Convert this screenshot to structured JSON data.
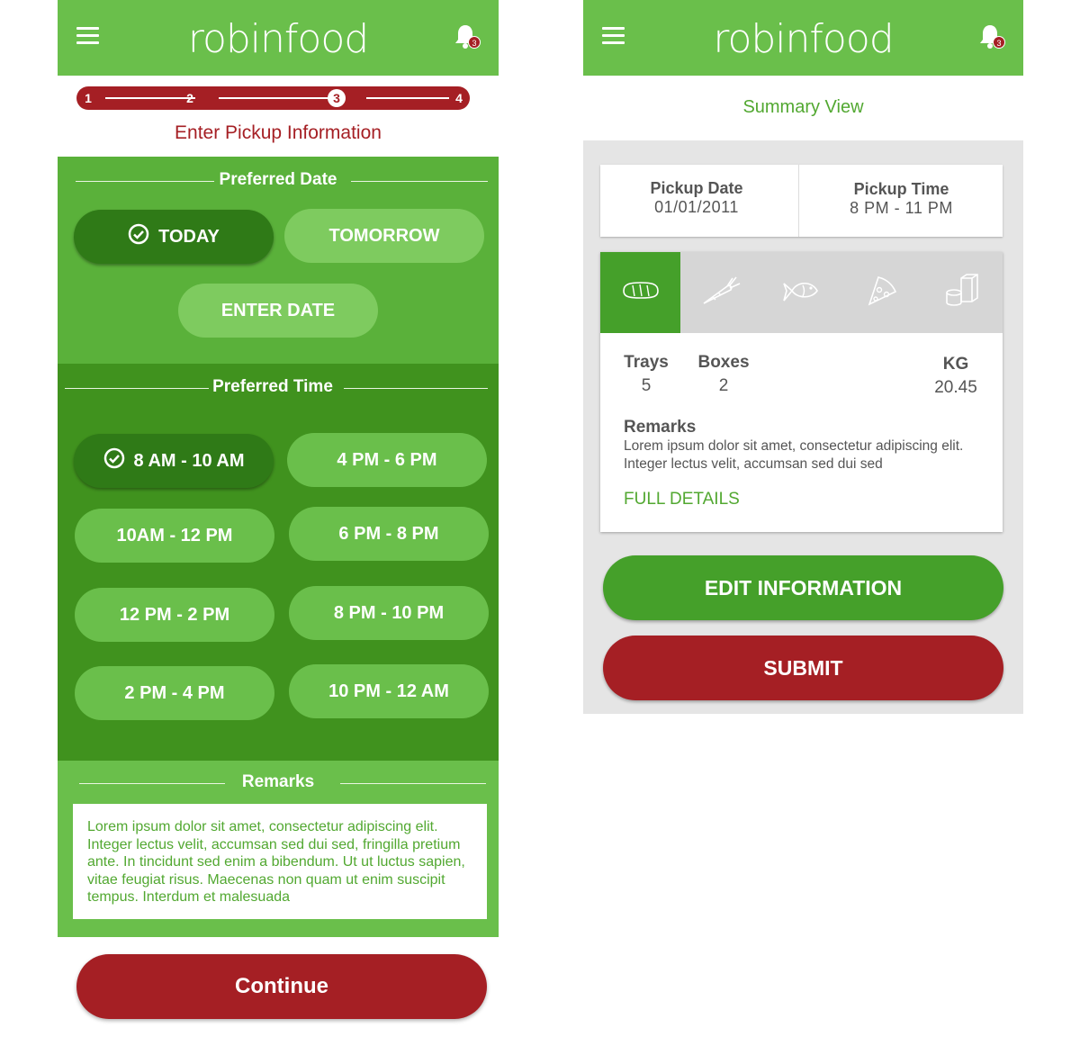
{
  "app": {
    "logo": "robinfood",
    "notification_count": "3"
  },
  "left": {
    "progress": {
      "steps": [
        "1",
        "2",
        "3",
        "4"
      ],
      "active_step": 3
    },
    "title": "Enter Pickup Information",
    "date_section": {
      "header": "Preferred Date",
      "options": {
        "today": "TODAY",
        "tomorrow": "TOMORROW",
        "enter_date": "ENTER DATE"
      },
      "selected": "TODAY"
    },
    "time_section": {
      "header": "Preferred Time",
      "slots": [
        "8 AM - 10 AM",
        "4 PM - 6 PM",
        "10AM - 12 PM",
        "6 PM - 8 PM",
        "12 PM - 2 PM",
        "8 PM - 10 PM",
        "2 PM - 4 PM",
        "10 PM - 12 AM"
      ],
      "selected": "8 AM - 10 AM"
    },
    "remarks": {
      "header": "Remarks",
      "text": "Lorem ipsum dolor sit amet, consectetur adipiscing elit. Integer lectus velit, accumsan sed dui sed, fringilla pretium ante. In tincidunt sed enim a bibendum. Ut ut luctus sapien, vitae feugiat risus. Maecenas non quam ut enim suscipit tempus. Interdum et malesuada"
    },
    "continue_label": "Continue"
  },
  "right": {
    "title": "Summary View",
    "pickup_date": {
      "label": "Pickup Date",
      "value": "01/01/2011"
    },
    "pickup_time": {
      "label": "Pickup Time",
      "value": "8 PM - 11 PM"
    },
    "tabs": [
      "bread-icon",
      "carrot-icon",
      "fish-icon",
      "pizza-icon",
      "cans-icon"
    ],
    "active_tab": "bread-icon",
    "trays": {
      "label": "Trays",
      "value": "5"
    },
    "boxes": {
      "label": "Boxes",
      "value": "2"
    },
    "kg": {
      "label": "KG",
      "value": "20.45"
    },
    "remarks": {
      "label": "Remarks",
      "text": "Lorem ipsum dolor sit amet, consectetur adipiscing elit. Integer lectus velit, accumsan sed dui sed"
    },
    "full_details_label": "FULL DETAILS",
    "edit_label": "EDIT INFORMATION",
    "submit_label": "SUBMIT"
  },
  "colors": {
    "brand_green": "#6abf4b",
    "dark_green": "#40921e",
    "selected_green": "#2f7a17",
    "brand_red": "#a51f24",
    "gray_bg": "#e5e5e5"
  }
}
